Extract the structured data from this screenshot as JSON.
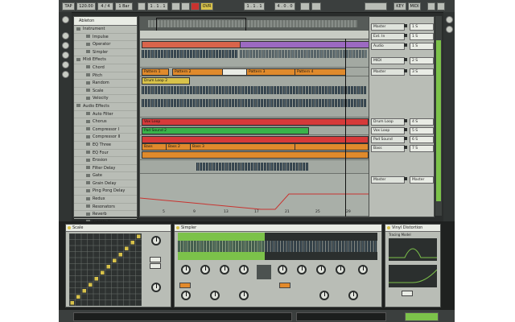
{
  "transport": {
    "buttons": [
      "TAP",
      "120.00",
      "4 / 4",
      "1 Bar",
      "1 . 1 . 1",
      "4 . 0 . 0",
      "OVR",
      "KEY",
      "MIDI"
    ],
    "record_color": "#c8332f"
  },
  "browser": {
    "header": "Ableton",
    "items": [
      {
        "label": "Instrument",
        "child": false
      },
      {
        "label": "Impulse",
        "child": true
      },
      {
        "label": "Operator",
        "child": true
      },
      {
        "label": "Simpler",
        "child": true
      },
      {
        "label": "Midi Effects",
        "child": false
      },
      {
        "label": "Chord",
        "child": true
      },
      {
        "label": "Pitch",
        "child": true
      },
      {
        "label": "Random",
        "child": true
      },
      {
        "label": "Scale",
        "child": true
      },
      {
        "label": "Velocity",
        "child": true
      },
      {
        "label": "Audio Effects",
        "child": false
      },
      {
        "label": "Auto Filter",
        "child": true
      },
      {
        "label": "Chorus",
        "child": true
      },
      {
        "label": "Compressor I",
        "child": true
      },
      {
        "label": "Compressor II",
        "child": true
      },
      {
        "label": "EQ Three",
        "child": true
      },
      {
        "label": "EQ Four",
        "child": true
      },
      {
        "label": "Erosion",
        "child": true
      },
      {
        "label": "Filter Delay",
        "child": true
      },
      {
        "label": "Gate",
        "child": true
      },
      {
        "label": "Grain Delay",
        "child": true
      },
      {
        "label": "Ping Pong Delay",
        "child": true
      },
      {
        "label": "Redux",
        "child": true
      },
      {
        "label": "Resonators",
        "child": true
      },
      {
        "label": "Reverb",
        "child": true
      },
      {
        "label": "Simple Delay",
        "child": true
      }
    ]
  },
  "arrangement": {
    "bar_labels": [
      "5",
      "9",
      "13",
      "17",
      "21",
      "25",
      "29"
    ],
    "clips_row1": [
      {
        "label": "",
        "color": "#d9644b"
      },
      {
        "label": "",
        "color": "#9c6ac2"
      }
    ],
    "clips_row2": [
      {
        "label": "Pattern 1",
        "color": "#e08a2c"
      },
      {
        "label": "Pattern 2",
        "color": "#e08a2c"
      },
      {
        "label": "",
        "color": "#e9ece5"
      },
      {
        "label": "Pattern 3",
        "color": "#e08a2c"
      },
      {
        "label": "Pattern 4",
        "color": "#e08a2c"
      }
    ],
    "clips_row3": [
      {
        "label": "Drum Loop 2",
        "color": "#d8c24a"
      }
    ],
    "clips_row4": [
      {
        "label": "Vox Loop",
        "color": "#d63a3a"
      }
    ],
    "clips_row5": [
      {
        "label": "Pad Sound 2",
        "color": "#39b34a"
      }
    ],
    "clips_row6": [
      {
        "label": "Bass",
        "color": "#e08a2c"
      },
      {
        "label": "Bass 2",
        "color": "#e08a2c"
      },
      {
        "label": "Bass 3",
        "color": "#e08a2c"
      }
    ]
  },
  "mixer": {
    "rows": [
      {
        "name": "Master",
        "value": "1 S"
      },
      {
        "name": "Ext. In",
        "value": "1 S"
      },
      {
        "name": "Audio",
        "value": "1 S"
      },
      {
        "name": "MIDI",
        "value": "2 S"
      },
      {
        "name": "Master",
        "value": "3 S"
      },
      {
        "name": "Drum Loop",
        "value": "4 S"
      },
      {
        "name": "Vox Loop",
        "value": "5 S"
      },
      {
        "name": "Pad Sound",
        "value": "6 S"
      },
      {
        "name": "Bass",
        "value": "7 S"
      },
      {
        "name": "Master",
        "value": "Master"
      }
    ]
  },
  "devices": {
    "scale": {
      "title": "Scale"
    },
    "sampler": {
      "title": "Simpler"
    },
    "vinyl": {
      "title": "Vinyl Distortion",
      "subtitle": "Tracing Model"
    },
    "accent": "#7cc24a"
  }
}
